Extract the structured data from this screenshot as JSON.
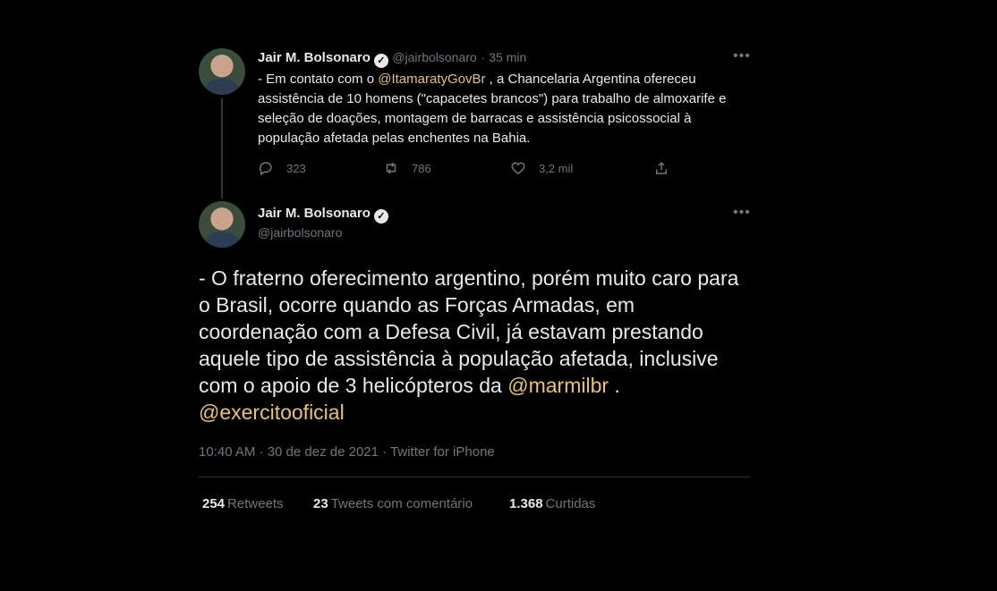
{
  "tweet1": {
    "author": "Jair M. Bolsonaro",
    "handle": "@jairbolsonaro",
    "sep": "·",
    "time": "35 min",
    "text_before": "- Em contato com o ",
    "mention": "@ItamaratyGovBr",
    "text_after": " , a Chancelaria Argentina ofereceu assistência de 10 homens (\"capacetes brancos\") para trabalho de almoxarife e seleção de doações, montagem de barracas e assistência psicossocial à população afetada pelas enchentes na Bahia.",
    "replies": "323",
    "retweets": "786",
    "likes": "3,2 mil"
  },
  "tweet2": {
    "author": "Jair M. Bolsonaro",
    "handle": "@jairbolsonaro",
    "text": "- O fraterno oferecimento argentino, porém muito caro para o Brasil, ocorre quando as Forças Armadas, em coordenação com a Defesa Civil, já estavam prestando aquele tipo de assistência à população afetada, inclusive com o apoio de 3 helicópteros da ",
    "mention1": "@marmilbr",
    "mid": " .",
    "mention2": "@exercitooficial",
    "meta": "10:40 AM · 30 de dez de 2021 · Twitter for iPhone",
    "stats": {
      "retweets_count": "254",
      "retweets_label": "Retweets",
      "quotes_count": "23",
      "quotes_label": "Tweets com comentário",
      "likes_count": "1.368",
      "likes_label": "Curtidas"
    }
  },
  "icons": {
    "more": "more-icon",
    "verified": "verified-badge-icon",
    "reply": "reply-icon",
    "retweet": "retweet-icon",
    "like": "heart-icon",
    "share": "share-icon"
  },
  "colors": {
    "background": "#000000",
    "mention": "#e9c26b",
    "muted": "#71767b",
    "text": "#e7e9ea"
  }
}
